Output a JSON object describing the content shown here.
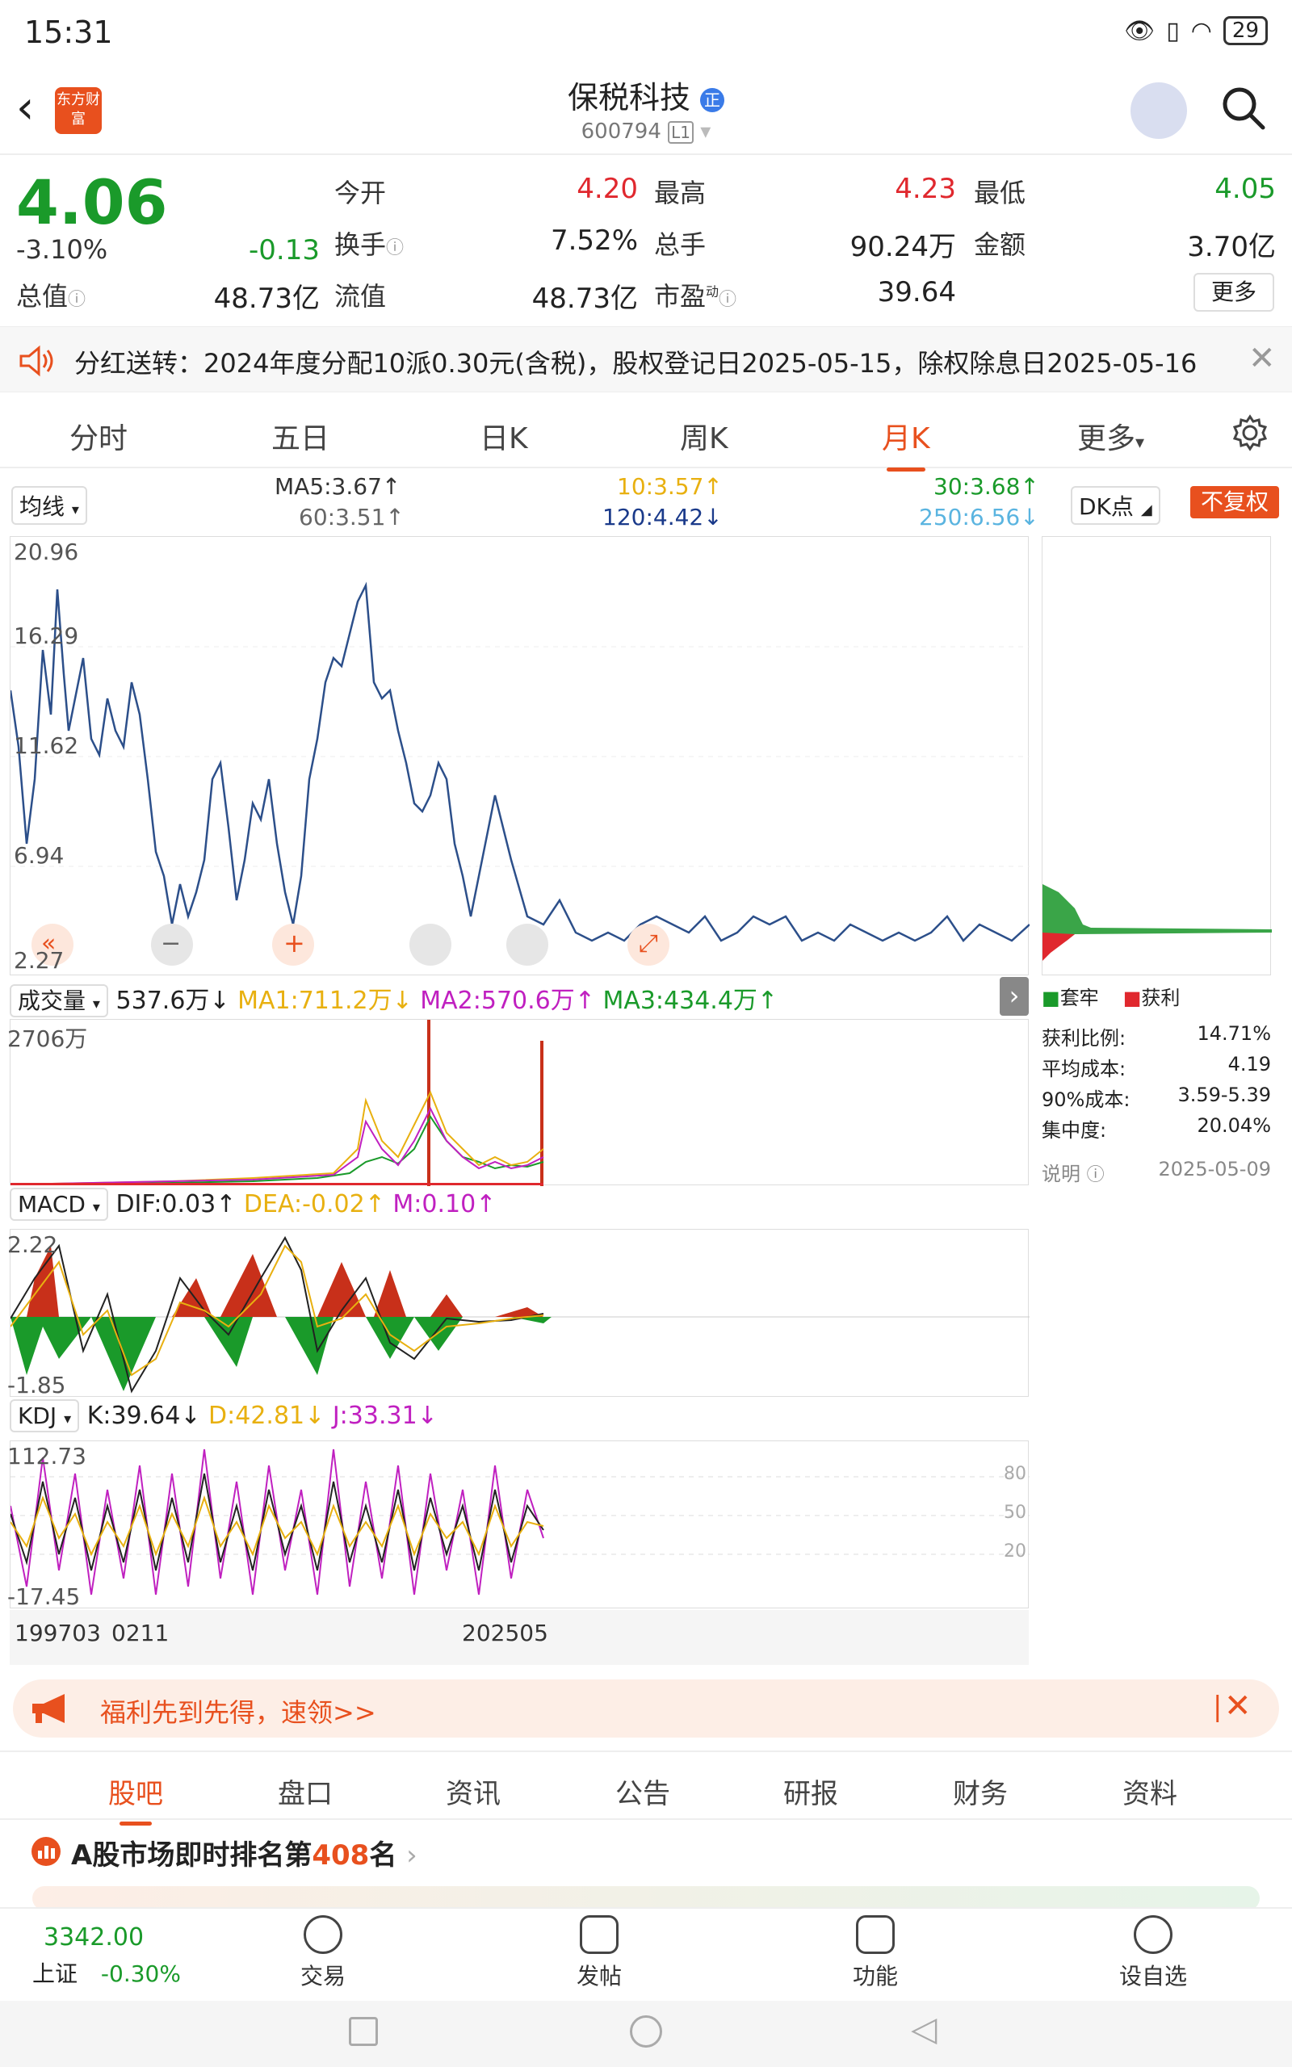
{
  "status": {
    "time": "15:31",
    "battery": "29"
  },
  "header": {
    "logo_text": "东方财富",
    "title": "保税科技",
    "badge": "正",
    "code": "600794",
    "market": "L1"
  },
  "quote": {
    "price": "4.06",
    "change_pct": "-3.10%",
    "change": "-0.13",
    "labels": {
      "open": "今开",
      "high": "最高",
      "low": "最低",
      "turnover": "换手",
      "volume": "总手",
      "amount": "金额",
      "total_mv": "总值",
      "float_mv": "流值",
      "pe": "市盈",
      "pe_sup": "动"
    },
    "open": "4.20",
    "high": "4.23",
    "low": "4.05",
    "turnover": "7.52%",
    "volume": "90.24万",
    "amount": "3.70亿",
    "total_mv": "48.73亿",
    "float_mv": "48.73亿",
    "pe": "39.64",
    "more": "更多"
  },
  "notice": {
    "text": "分红送转：2024年度分配10派0.30元(含税)，股权登记日2025-05-15，除权除息日2025-05-16"
  },
  "tabs": [
    "分时",
    "五日",
    "日K",
    "周K",
    "月K",
    "更多"
  ],
  "active_tab": "月K",
  "ma": {
    "select": "均线",
    "ma5": "MA5:3.67",
    "ma10": "10:3.57",
    "ma30": "30:3.68",
    "ma60": "60:3.51",
    "ma120": "120:4.42",
    "ma250": "250:6.56",
    "dk": "DK点",
    "fuquan": "不复权"
  },
  "price_chart": {
    "ticks": [
      "20.96",
      "16.29",
      "11.62",
      "6.94",
      "2.27"
    ]
  },
  "volume": {
    "select": "成交量",
    "value": "537.6万",
    "ma1": "MA1:711.2万",
    "ma2": "MA2:570.6万",
    "ma3": "MA3:434.4万",
    "max": "2706万"
  },
  "macd": {
    "select": "MACD",
    "dif": "DIF:0.03",
    "dea": "DEA:-0.02",
    "m": "M:0.10",
    "max": "2.22",
    "min": "-1.85"
  },
  "kdj": {
    "select": "KDJ",
    "k": "K:39.64",
    "d": "D:42.81",
    "j": "J:33.31",
    "max": "112.73",
    "min": "-17.45",
    "levels": [
      "80",
      "50",
      "20"
    ]
  },
  "dates": {
    "start": "199703",
    "mid": "0211",
    "end": "202505"
  },
  "chip": {
    "legend_trap": "套牢",
    "legend_profit": "获利",
    "rows": [
      {
        "label": "获利比例:",
        "value": "14.71%"
      },
      {
        "label": "平均成本:",
        "value": "4.19"
      },
      {
        "label": "90%成本:",
        "value": "3.59-5.39"
      },
      {
        "label": "集中度:",
        "value": "20.04%"
      }
    ],
    "note": "说明",
    "date": "2025-05-09"
  },
  "promo": {
    "text": "福利先到先得，速领>>"
  },
  "bottom_tabs": [
    "股吧",
    "盘口",
    "资讯",
    "公告",
    "研报",
    "财务",
    "资料"
  ],
  "rank": {
    "prefix": "A股市场即时排名第",
    "number": "408",
    "suffix": "名"
  },
  "index": {
    "value": "3342.00",
    "name": "上证",
    "change": "-0.30%"
  },
  "bottom_bar": [
    "交易",
    "发帖",
    "功能",
    "设自选"
  ]
}
